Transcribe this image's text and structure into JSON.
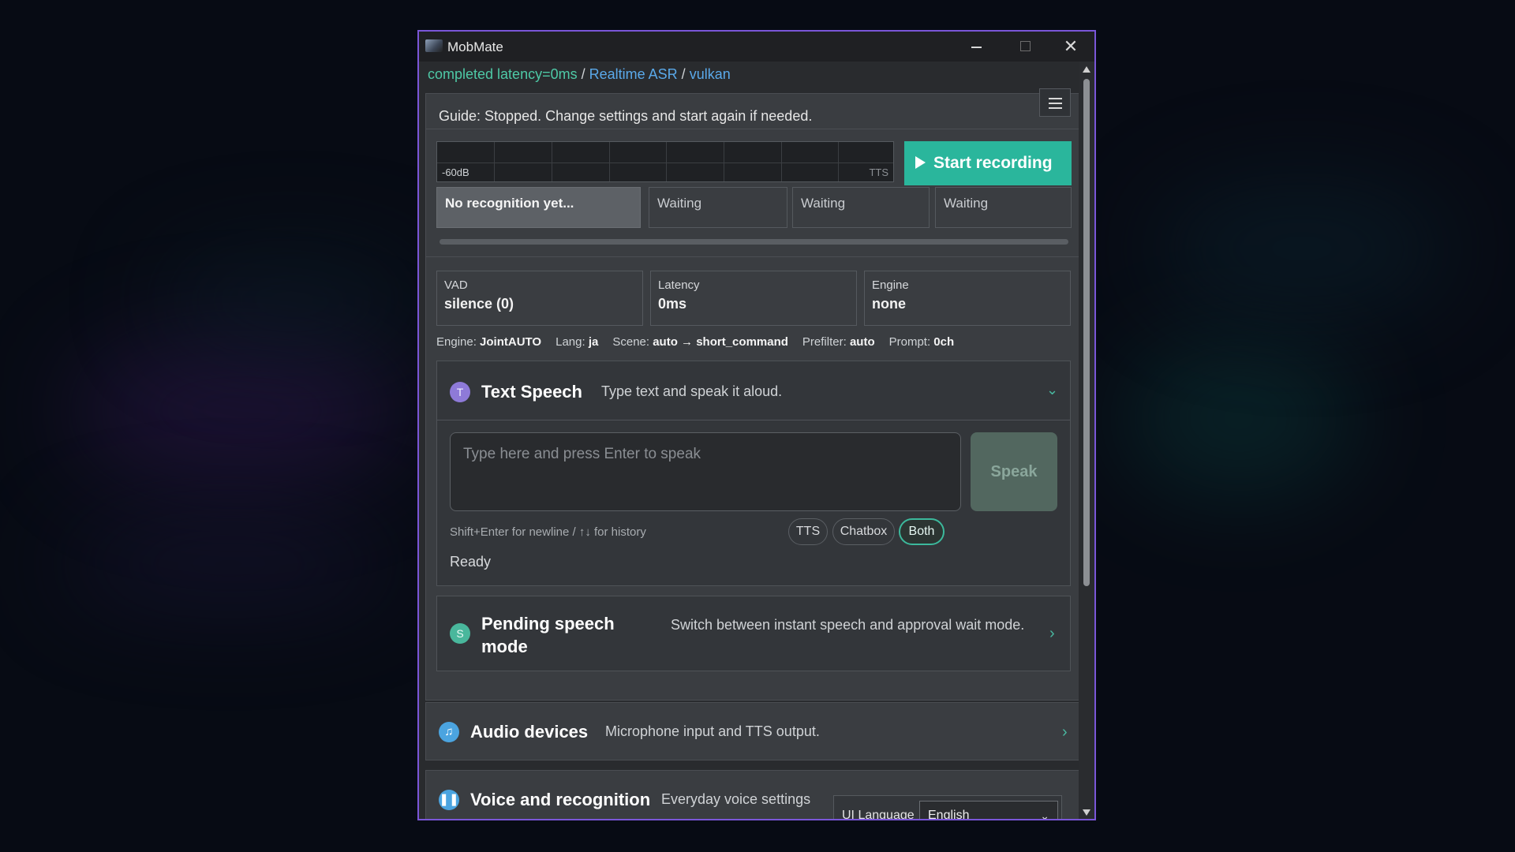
{
  "window": {
    "title": "MobMate"
  },
  "status": {
    "completed": "completed latency=0ms",
    "sep1": " / ",
    "mode": "Realtime ASR",
    "sep2": " / ",
    "backend": "vulkan"
  },
  "guide": "Guide: Stopped. Change settings and start again if needed.",
  "meter": {
    "left_label": "-60dB",
    "right_label": "TTS"
  },
  "start_button": "Start recording",
  "recognition": [
    {
      "text": "No recognition yet..."
    },
    {
      "text": "Waiting"
    },
    {
      "text": "Waiting"
    },
    {
      "text": "Waiting"
    }
  ],
  "stats": [
    {
      "key": "VAD",
      "value": "silence (0)"
    },
    {
      "key": "Latency",
      "value": "0ms"
    },
    {
      "key": "Engine",
      "value": "none"
    }
  ],
  "info": {
    "engine_k": "Engine:",
    "engine_v": "JointAUTO",
    "lang_k": "Lang:",
    "lang_v": "ja",
    "scene_k": "Scene:",
    "scene_v": "auto → short_command",
    "prefilter_k": "Prefilter:",
    "prefilter_v": "auto",
    "prompt_k": "Prompt:",
    "prompt_v": "0ch"
  },
  "text_speech": {
    "badge": "T",
    "title": "Text Speech",
    "desc": "Type text and speak it aloud.",
    "placeholder": "Type here and press Enter to speak",
    "speak": "Speak",
    "hint": "Shift+Enter for newline / ↑↓ for history",
    "targets": [
      "TTS",
      "Chatbox",
      "Both"
    ],
    "active_target": "Both",
    "status": "Ready"
  },
  "pending": {
    "badge": "S",
    "title": "Pending speech mode",
    "desc": "Switch between instant speech and approval wait mode."
  },
  "audio_devices": {
    "title": "Audio devices",
    "desc": "Microphone input and TTS output.",
    "icon": "music-note-icon"
  },
  "voice_recognition": {
    "title": "Voice and recognition",
    "desc": "Everyday voice settings",
    "icon": "pause-icon"
  },
  "ui_language": {
    "label": "UI Language",
    "value": "English"
  },
  "colors": {
    "accent": "#2ab69c",
    "window_border": "#7a56d8",
    "link_blue": "#5aa9ea"
  }
}
